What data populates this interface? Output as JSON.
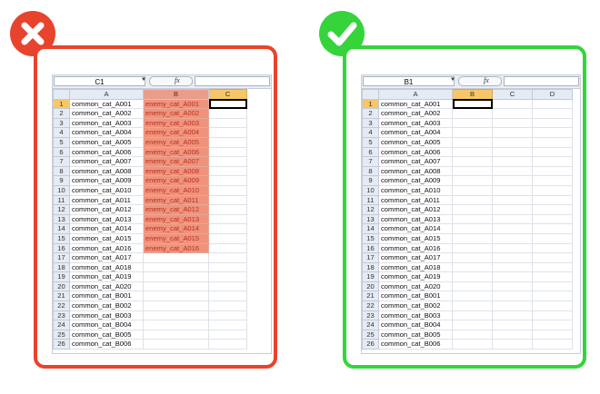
{
  "colors": {
    "wrong": "#e8432d",
    "correct": "#35d43b",
    "highlight": "#f0937c",
    "selected_header": "#f6c668"
  },
  "wrong_example": {
    "icon": "cross-icon",
    "namebox": "C1",
    "fx": "fx",
    "columns": [
      "A",
      "B",
      "C"
    ],
    "rows": [
      "1",
      "2",
      "3",
      "4",
      "5",
      "6",
      "7",
      "8",
      "9",
      "10",
      "11",
      "12",
      "13",
      "14",
      "15",
      "16",
      "17",
      "18",
      "19",
      "20",
      "21",
      "22",
      "23",
      "24",
      "25",
      "26"
    ],
    "col_a": [
      "common_cat_A001",
      "common_cat_A002",
      "common_cat_A003",
      "common_cat_A004",
      "common_cat_A005",
      "common_cat_A006",
      "common_cat_A007",
      "common_cat_A008",
      "common_cat_A009",
      "common_cat_A010",
      "common_cat_A011",
      "common_cat_A012",
      "common_cat_A013",
      "common_cat_A014",
      "common_cat_A015",
      "common_cat_A016",
      "common_cat_A017",
      "common_cat_A018",
      "common_cat_A019",
      "common_cat_A020",
      "common_cat_B001",
      "common_cat_B002",
      "common_cat_B003",
      "common_cat_B004",
      "common_cat_B005",
      "common_cat_B006"
    ],
    "col_b": [
      "enemy_cat_A001",
      "enemy_cat_A002",
      "enemy_cat_A003",
      "enemy_cat_A004",
      "enemy_cat_A005",
      "enemy_cat_A006",
      "enemy_cat_A007",
      "enemy_cat_A008",
      "enemy_cat_A009",
      "enemy_cat_A010",
      "enemy_cat_A011",
      "enemy_cat_A012",
      "enemy_cat_A013",
      "enemy_cat_A014",
      "enemy_cat_A015",
      "enemy_cat_A016",
      "",
      "",
      "",
      "",
      "",
      "",
      "",
      "",
      "",
      ""
    ]
  },
  "correct_example": {
    "icon": "checkmark-icon",
    "namebox": "B1",
    "fx": "fx",
    "columns": [
      "A",
      "B",
      "C",
      "D"
    ],
    "rows": [
      "1",
      "2",
      "3",
      "4",
      "5",
      "6",
      "7",
      "8",
      "9",
      "10",
      "11",
      "12",
      "13",
      "14",
      "15",
      "16",
      "17",
      "18",
      "19",
      "20",
      "21",
      "22",
      "23",
      "24",
      "25",
      "26"
    ],
    "col_a": [
      "common_cat_A001",
      "common_cat_A002",
      "common_cat_A003",
      "common_cat_A004",
      "common_cat_A005",
      "common_cat_A006",
      "common_cat_A007",
      "common_cat_A008",
      "common_cat_A009",
      "common_cat_A010",
      "common_cat_A011",
      "common_cat_A012",
      "common_cat_A013",
      "common_cat_A014",
      "common_cat_A015",
      "common_cat_A016",
      "common_cat_A017",
      "common_cat_A018",
      "common_cat_A019",
      "common_cat_A020",
      "common_cat_B001",
      "common_cat_B002",
      "common_cat_B003",
      "common_cat_B004",
      "common_cat_B005",
      "common_cat_B006"
    ]
  }
}
